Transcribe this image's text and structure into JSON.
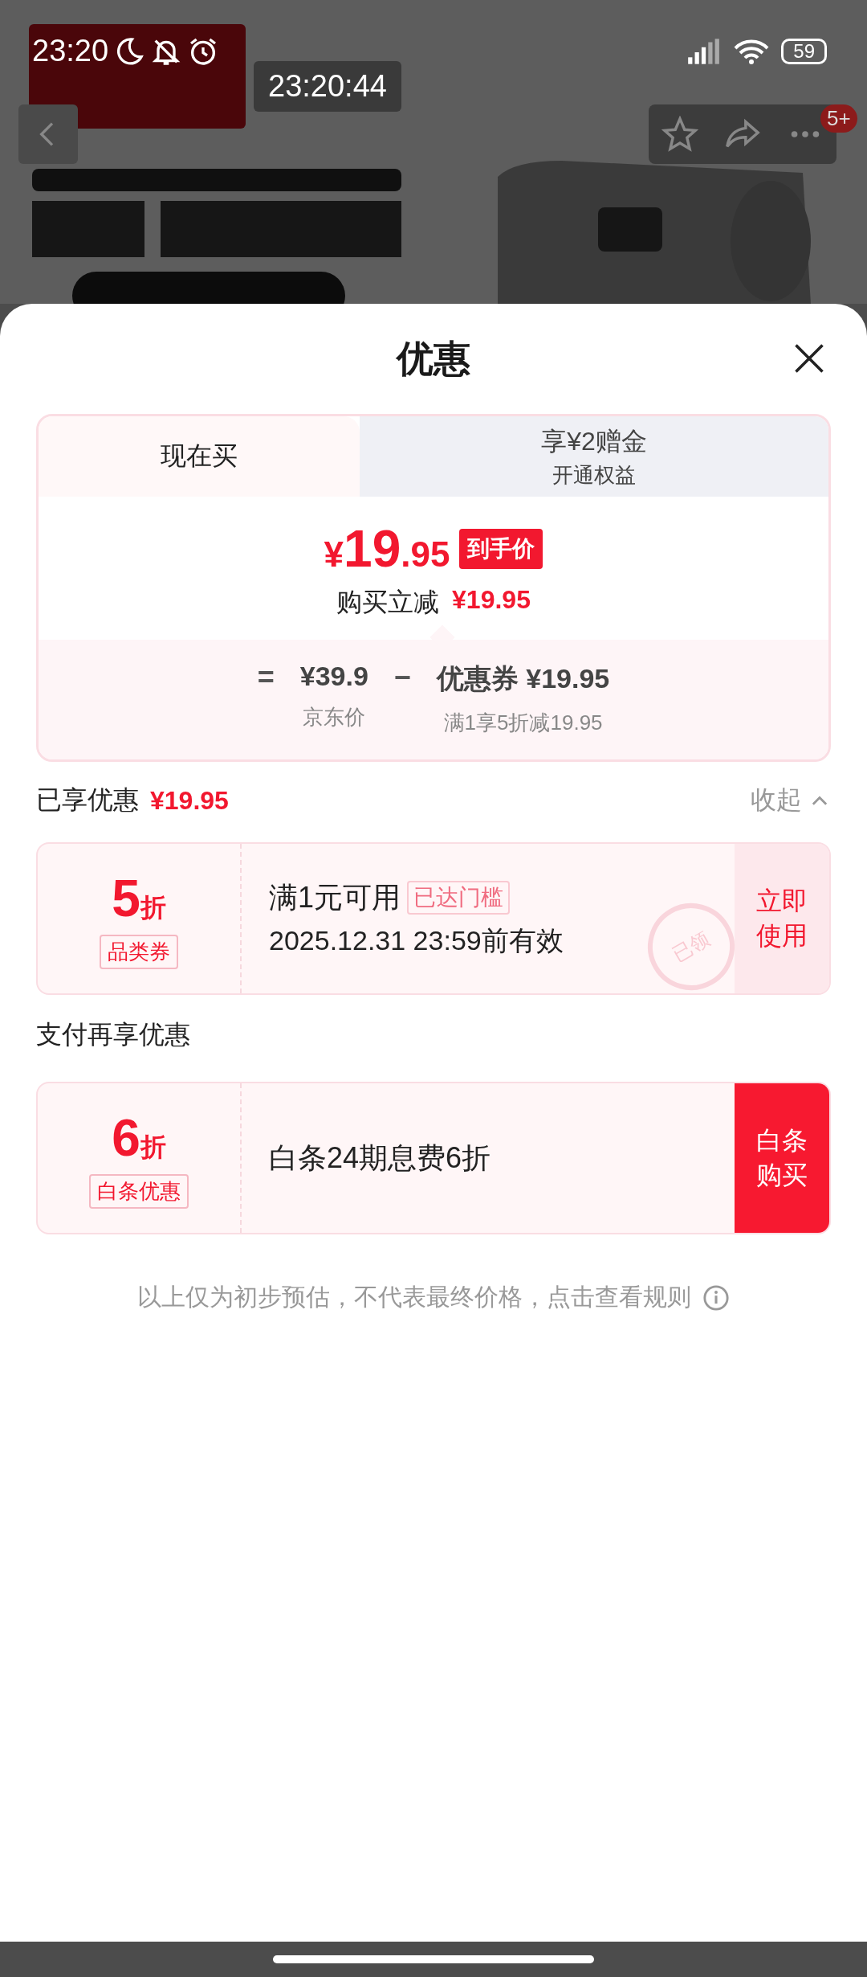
{
  "status_bar": {
    "time": "23:20",
    "battery": "59"
  },
  "clock_overlay": "23:20:44",
  "header": {
    "badge": "5+"
  },
  "sheet": {
    "title": "优惠"
  },
  "tabs": [
    {
      "label": "现在买",
      "selected": true
    },
    {
      "label": "享¥2赠金",
      "sublabel": "开通权益",
      "selected": false
    }
  ],
  "price": {
    "symbol": "¥",
    "integer": "19",
    "decimal": ".95",
    "tag": "到手价",
    "saving_label": "购买立减",
    "saving_value": "¥19.95"
  },
  "formula": {
    "equals": "=",
    "base_value": "¥39.9",
    "base_label": "京东价",
    "minus": "−",
    "coupon_value": "优惠券 ¥19.95",
    "coupon_label": "满1享5折减19.95"
  },
  "enjoyed": {
    "label": "已享优惠",
    "value": "¥19.95",
    "toggle": "收起",
    "expanded": true
  },
  "coupons": [
    {
      "kind": "coupon",
      "discount": "5",
      "unit": "折",
      "type": "品类券",
      "condition": "满1元可用",
      "condition_tag": "已达门槛",
      "validity": "2025.12.31 23:59前有效",
      "stamp": "已领",
      "action": "立即使用"
    }
  ],
  "pay_section": {
    "title": "支付再享优惠"
  },
  "pay_offers": [
    {
      "kind": "payment",
      "discount": "6",
      "unit": "折",
      "type": "白条优惠",
      "condition": "白条24期息费6折",
      "action": "白条购买"
    }
  ],
  "footer": {
    "note": "以上仅为初步预估，不代表最终价格，点击查看规则"
  }
}
